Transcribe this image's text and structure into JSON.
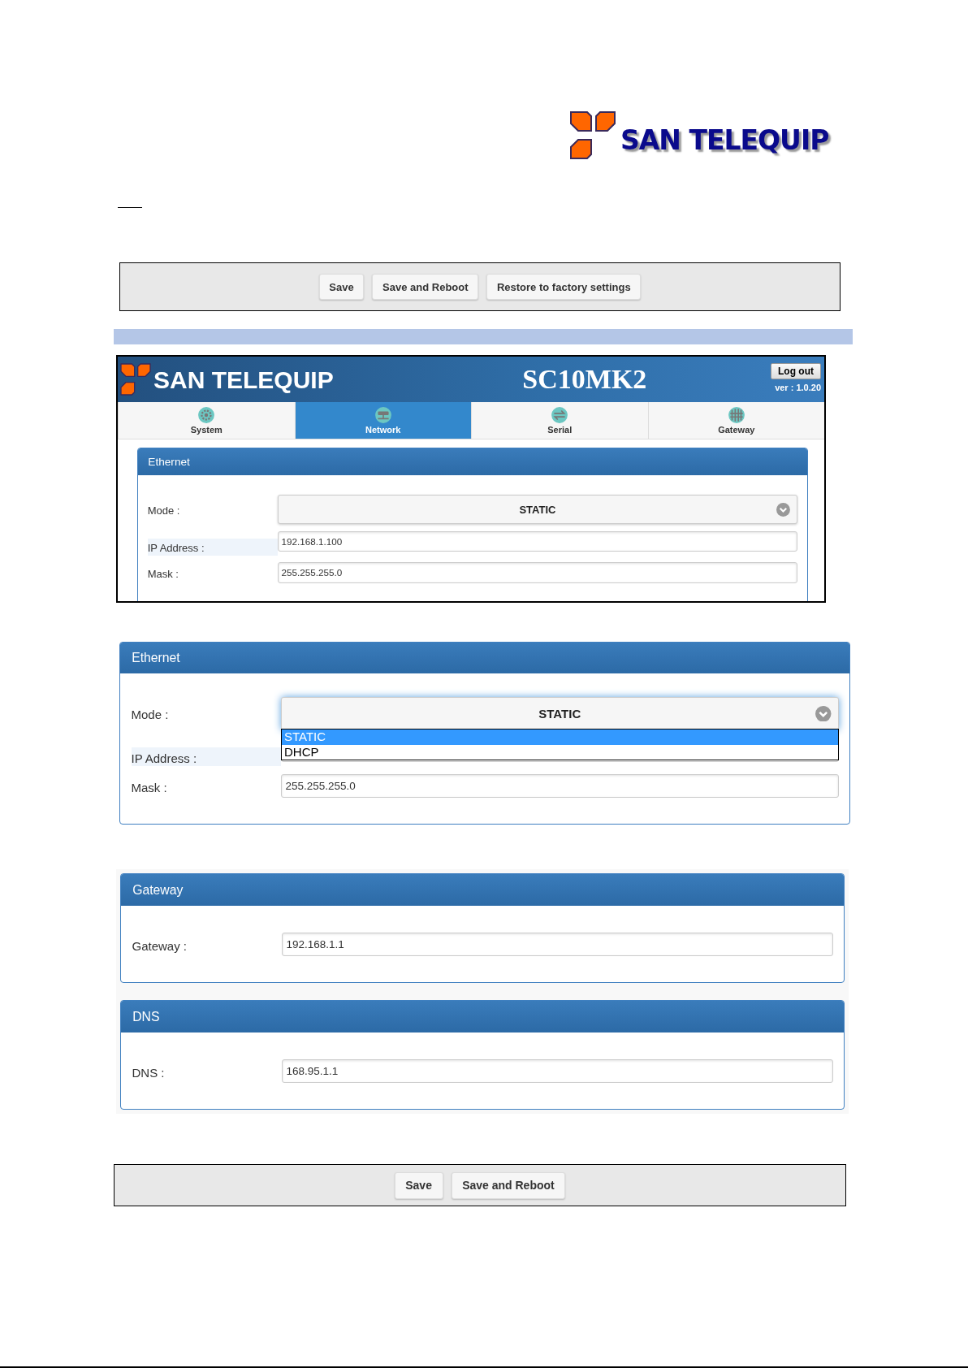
{
  "header_logo": {
    "text": "SAN TELEQUIP"
  },
  "toolbar_top": {
    "buttons": [
      "Save",
      "Save and Reboot",
      "Restore to factory settings"
    ]
  },
  "app_screenshot": {
    "logo": "SAN TELEQUIP",
    "title": "SC10MK2",
    "logout": "Log out",
    "version": "ver : 1.0.20",
    "tabs": [
      {
        "label": "System",
        "selected": false
      },
      {
        "label": "Network",
        "selected": true
      },
      {
        "label": "Serial",
        "selected": false
      },
      {
        "label": "Gateway",
        "selected": false
      }
    ],
    "panel": {
      "title": "Ethernet",
      "fields": [
        {
          "kind": "select",
          "label": "Mode :",
          "value": "STATIC",
          "highlighted": false
        },
        {
          "kind": "text",
          "label": "IP Address :",
          "value": "192.168.1.100",
          "highlighted": true
        },
        {
          "kind": "text",
          "label": "Mask :",
          "value": "255.255.255.0",
          "highlighted": false
        }
      ]
    }
  },
  "ethernet_dropdown": {
    "title": "Ethernet",
    "fields": [
      {
        "kind": "select",
        "label": "Mode :",
        "value": "STATIC",
        "highlighted": false,
        "expanded": true,
        "options": [
          {
            "label": "STATIC",
            "selected": true
          },
          {
            "label": "DHCP",
            "selected": false
          }
        ]
      },
      {
        "kind": "text",
        "label": "IP Address :",
        "highlighted": true
      },
      {
        "kind": "text",
        "label": "Mask :",
        "value": "255.255.255.0",
        "highlighted": false
      }
    ]
  },
  "gateway_panel": {
    "title": "Gateway",
    "fields": [
      {
        "kind": "text",
        "label": "Gateway :",
        "value": "192.168.1.1",
        "highlighted": false
      }
    ]
  },
  "dns_panel": {
    "title": "DNS",
    "fields": [
      {
        "kind": "text",
        "label": "DNS :",
        "value": "168.95.1.1",
        "highlighted": false
      }
    ]
  },
  "toolbar_bottom": {
    "buttons": [
      "Save",
      "Save and Reboot"
    ]
  }
}
